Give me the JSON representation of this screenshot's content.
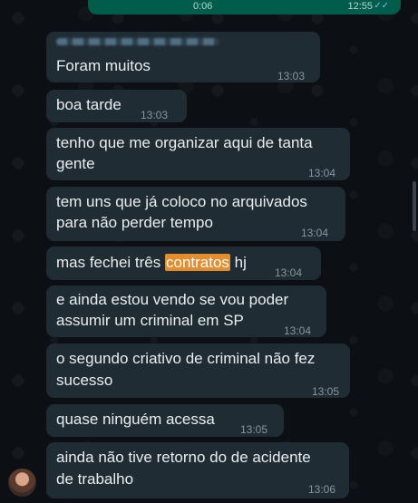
{
  "sent_preview": {
    "duration": "0:06",
    "time": "12:55",
    "status_icon": "double-check-icon"
  },
  "messages": [
    {
      "line1": "Foram muitos",
      "time": "13:03"
    },
    {
      "line1": "boa tarde",
      "time": "13:03"
    },
    {
      "line1": "tenho que me organizar aqui de tanta",
      "line2": "gente",
      "time": "13:04"
    },
    {
      "line1": "tem uns que já coloco no arquivados",
      "line2": "para não perder tempo",
      "time": "13:04"
    },
    {
      "before": "mas fechei três ",
      "highlight": "contratos",
      "after": " hj",
      "time": "13:04"
    },
    {
      "line1": "e ainda estou vendo se vou poder",
      "line2": "assumir um criminal em SP",
      "time": "13:04"
    },
    {
      "line1": "o segundo criativo de criminal não fez",
      "line2": "sucesso",
      "time": "13:05"
    },
    {
      "line1": "quase ninguém acessa",
      "time": "13:05"
    },
    {
      "line1": "ainda não tive retorno do de acidente",
      "line2": "de trabalho",
      "time": "13:06"
    }
  ],
  "colors": {
    "bubble": "#202c33",
    "background": "#0c1014",
    "highlight": "#e38d2c",
    "sent": "#005c4b"
  }
}
